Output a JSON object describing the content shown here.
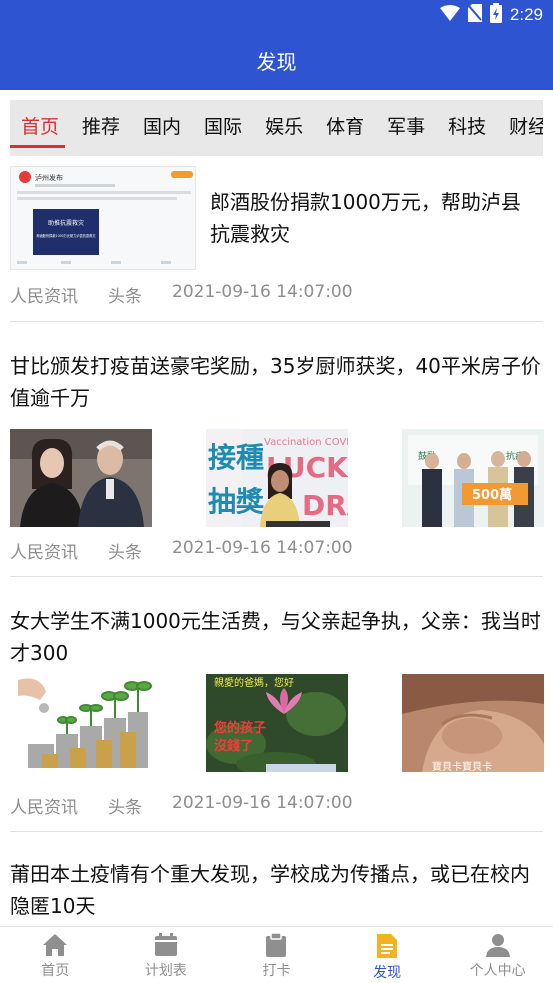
{
  "status_bar": {
    "time": "2:29",
    "icons": [
      "wifi-icon",
      "no-sim-icon",
      "battery-charging-icon"
    ]
  },
  "app_bar": {
    "title": "发现"
  },
  "category_tabs": [
    {
      "label": "首页",
      "active": true
    },
    {
      "label": "推荐"
    },
    {
      "label": "国内"
    },
    {
      "label": "国际"
    },
    {
      "label": "娱乐"
    },
    {
      "label": "体育"
    },
    {
      "label": "军事"
    },
    {
      "label": "科技"
    },
    {
      "label": "财经"
    }
  ],
  "feed": [
    {
      "title": "郎酒股份捐款1000万元，帮助泸县抗震救灾",
      "source": "人民资讯",
      "channel": "头条",
      "time": "2021-09-16 14:07:00",
      "thumb_texts": [
        "泸州发布",
        "助推抗震救灾",
        "郎酒股份捐款1000万元助力泸县抗震救灾"
      ]
    },
    {
      "title": "甘比颁发打疫苗送豪宅奖励，35岁厨师获奖，40平米房子价值逾千万",
      "source": "人民资讯",
      "channel": "头条",
      "time": "2021-09-16 14:07:00",
      "image_texts": [
        "接種",
        "抽獎",
        "Vaccination COVID",
        "LUCKY",
        "DRAW",
        "500萬",
        "鼓勵",
        "抗疫"
      ]
    },
    {
      "title": "女大学生不满1000元生活费，与父亲起争执，父亲：我当时才300",
      "source": "人民资讯",
      "channel": "头条",
      "time": "2021-09-16 14:07:00",
      "image_texts": [
        "親愛的爸媽，您好",
        "您的孩子",
        "沒錢了",
        "寶貝卡寶貝卡"
      ]
    },
    {
      "title": "莆田本土疫情有个重大发现，学校成为传播点，或已在校内隐匿10天"
    }
  ],
  "bottom_nav": [
    {
      "label": "首页",
      "icon": "home-icon"
    },
    {
      "label": "计划表",
      "icon": "calendar-icon"
    },
    {
      "label": "打卡",
      "icon": "clipboard-icon"
    },
    {
      "label": "发现",
      "icon": "document-icon",
      "active": true
    },
    {
      "label": "个人中心",
      "icon": "person-icon"
    }
  ],
  "colors": {
    "primary": "#2f54d2",
    "tab_active": "#d8322e",
    "meta_text": "#8e8e8e",
    "tab_background": "#e8e8e8"
  }
}
